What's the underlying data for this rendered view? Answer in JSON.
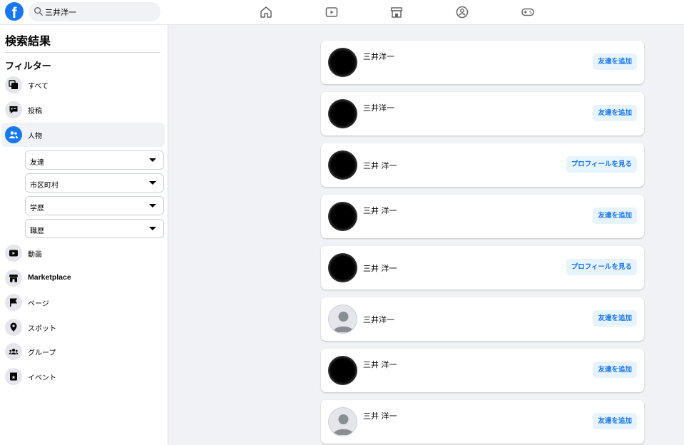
{
  "header": {
    "logo_letter": "f",
    "search_value": "三井洋一",
    "nav_icons": [
      "home-icon",
      "watch-icon",
      "marketplace-icon",
      "groups-icon",
      "gaming-icon"
    ]
  },
  "sidebar": {
    "title": "検索結果",
    "filter_heading": "フィルター",
    "items": [
      {
        "label": "すべて",
        "icon": "all-icon"
      },
      {
        "label": "投稿",
        "icon": "posts-icon"
      },
      {
        "label": "人物",
        "icon": "people-icon",
        "active": true
      },
      {
        "label": "動画",
        "icon": "video-icon"
      },
      {
        "label": "Marketplace",
        "icon": "marketplace-icon"
      },
      {
        "label": "ページ",
        "icon": "page-flag-icon"
      },
      {
        "label": "スポット",
        "icon": "location-pin-icon"
      },
      {
        "label": "グループ",
        "icon": "groups-icon"
      },
      {
        "label": "イベント",
        "icon": "event-icon"
      }
    ],
    "people_filters": [
      "友達",
      "市区町村",
      "学歴",
      "職歴"
    ]
  },
  "results": [
    {
      "name": "三井洋一",
      "avatar": "blurred",
      "button": "友達を追加"
    },
    {
      "name": "三井洋一",
      "avatar": "blurred",
      "button": "友達を追加"
    },
    {
      "name": "三井 洋一",
      "avatar": "blurred",
      "button": "プロフィールを見る"
    },
    {
      "name": "三井 洋一",
      "avatar": "blurred",
      "button": "友達を追加"
    },
    {
      "name": "三井 洋一",
      "avatar": "blurred",
      "button": "プロフィールを見る"
    },
    {
      "name": "三井洋一",
      "avatar": "default",
      "button": "友達を追加"
    },
    {
      "name": "三井 洋一",
      "avatar": "blurred",
      "button": "友達を追加"
    },
    {
      "name": "三井 洋一",
      "avatar": "default",
      "button": "友達を追加"
    }
  ],
  "colors": {
    "brand": "#1877f2",
    "button_bg": "#e7f3ff",
    "page_bg": "#f0f2f5"
  }
}
